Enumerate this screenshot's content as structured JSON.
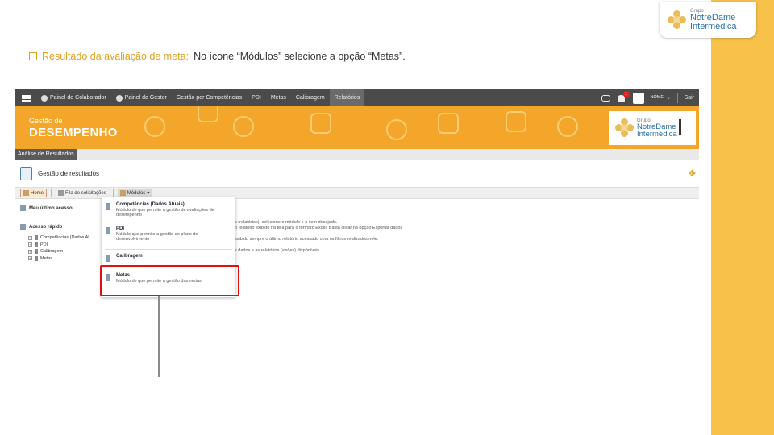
{
  "instruction": {
    "label": "Resultado da avaliação de meta:",
    "text": "No ícone “Módulos” selecione a opção “Metas”."
  },
  "slide_logo": {
    "grupo": "Grupo",
    "line1": "NotreDame",
    "line2": "Intermédica"
  },
  "app": {
    "nav": [
      {
        "label": "Painel do Colaborador"
      },
      {
        "label": "Painel do Gestor"
      },
      {
        "label": "Gestão por Competências"
      },
      {
        "label": "PDI"
      },
      {
        "label": "Metas"
      },
      {
        "label": "Calibragem"
      },
      {
        "label": "Relatórios"
      }
    ],
    "notification_count": "1",
    "user_name": "NOME",
    "logout_label": "Sair",
    "banner": {
      "title_small": "Gestão de",
      "title_big": "DESEMPENHO",
      "logo": {
        "grupo": "Grupo",
        "line1": "NotreDame",
        "line2": "Intermédica"
      }
    },
    "tab_label": "Análise de Resultados",
    "page_title": "Gestão de resultados",
    "toolbar": {
      "home": "Home",
      "filters": "Fila de solicitações",
      "modules": "Módulos"
    },
    "left_panel": {
      "last_access": "Meu último acesso",
      "quick_access": "Acesso rápido",
      "tree": [
        "Competências (Dados AL",
        "PDI",
        "Calibragem",
        "Metas"
      ]
    },
    "body_lines": [
      "s (relatórios), selecione o módulo e o item desejado.",
      "o relatório exibido na tela para o formato Excel. Basta clicar na opção Exportar dados",
      "",
      "ssibido sempre o último relatório acessado com os filtros realizados nele.",
      "",
      "s dados e as relatórios (visões) dispóníveis."
    ],
    "dropdown": [
      {
        "title": "Competências (Dados Atuais)",
        "desc": "Módulo de que permite a gestão de avaliações de desempenho"
      },
      {
        "title": "PDI",
        "desc": "Módulo que permite a gestão do plano de desenvolvimento"
      },
      {
        "title": "Calibragem",
        "desc": ""
      },
      {
        "title": "Metas",
        "desc": "Módulo de que permite a gestão das metas"
      }
    ]
  }
}
